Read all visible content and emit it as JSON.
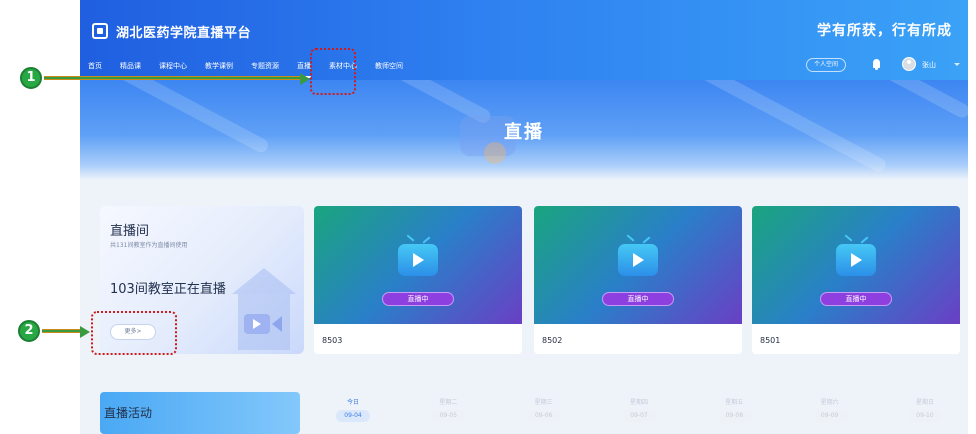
{
  "header": {
    "brand": "湖北医药学院直播平台",
    "slogan": "学有所获，行有所成"
  },
  "nav": {
    "items": [
      {
        "label": "首页"
      },
      {
        "label": "精品课"
      },
      {
        "label": "课程中心"
      },
      {
        "label": "教学课例"
      },
      {
        "label": "专题资源"
      },
      {
        "label": "直播",
        "active": true
      },
      {
        "label": "素材中心"
      },
      {
        "label": "教师空间"
      }
    ]
  },
  "user": {
    "personal_space": "个人空间",
    "name": "张山"
  },
  "banner": {
    "title": "直播"
  },
  "room_panel": {
    "title": "直播间",
    "subtitle": "共131间教室作为直播间使用",
    "live_text": "103间教室正在直播",
    "more_label": "更多>"
  },
  "live_cards": [
    {
      "badge": "直播中",
      "name": "8503"
    },
    {
      "badge": "直播中",
      "name": "8502"
    },
    {
      "badge": "直播中",
      "name": "8501"
    }
  ],
  "activity": {
    "title": "直播活动",
    "week": [
      {
        "day": "今日",
        "date": "09-04",
        "active": true
      },
      {
        "day": "星期二",
        "date": "09-05"
      },
      {
        "day": "星期三",
        "date": "09-06"
      },
      {
        "day": "星期四",
        "date": "09-07"
      },
      {
        "day": "星期五",
        "date": "09-08"
      },
      {
        "day": "星期六",
        "date": "09-09"
      },
      {
        "day": "星期日",
        "date": "09-10"
      }
    ]
  },
  "annotations": {
    "marker_1": "1",
    "marker_2": "2",
    "colors": {
      "marker": "#27a844",
      "arrow": "#3a9a3f",
      "highlight": "#d11a1a"
    }
  },
  "colors": {
    "header_start": "#1f5fe0",
    "header_end": "#3aa2f7",
    "live_badge": "#8e3fe0"
  }
}
